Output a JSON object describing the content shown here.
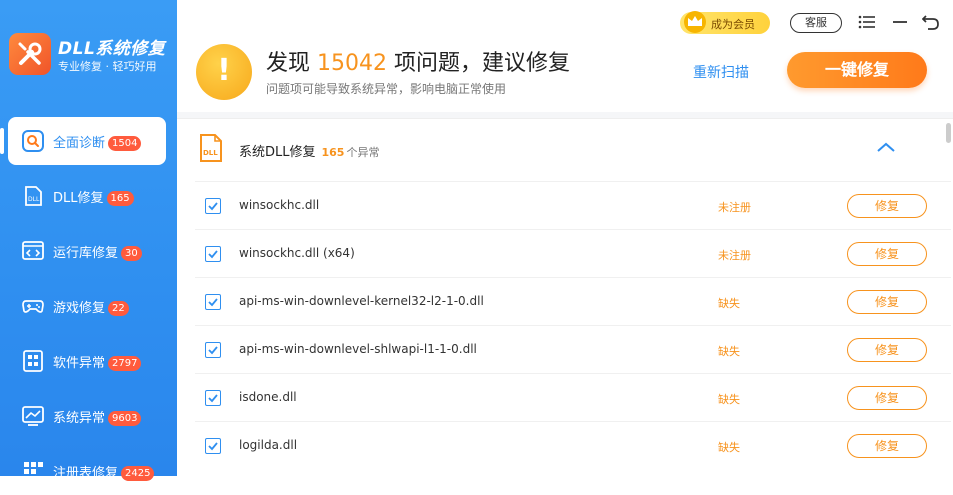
{
  "app": {
    "name": "DLL系统修复",
    "slogan": "专业修复 · 轻巧好用"
  },
  "topbar": {
    "vip_label": "成为会员",
    "service_label": "客服"
  },
  "header": {
    "prefix": "发现 ",
    "count": "15042",
    "suffix": " 项问题，建议修复",
    "subtitle": "问题项可能导致系统异常，影响电脑正常使用",
    "rescan_label": "重新扫描",
    "fix_all_label": "一键修复"
  },
  "sidebar": {
    "items": [
      {
        "label": "全面诊断",
        "badge": "1504",
        "icon": "search-icon"
      },
      {
        "label": "DLL修复",
        "badge": "165",
        "icon": "dll-icon"
      },
      {
        "label": "运行库修复",
        "badge": "30",
        "icon": "code-icon"
      },
      {
        "label": "游戏修复",
        "badge": "22",
        "icon": "gamepad-icon"
      },
      {
        "label": "软件异常",
        "badge": "2797",
        "icon": "apps-icon"
      },
      {
        "label": "系统异常",
        "badge": "9603",
        "icon": "monitor-chart-icon"
      },
      {
        "label": "注册表修复",
        "badge": "2425",
        "icon": "registry-icon"
      }
    ]
  },
  "section": {
    "title": "系统DLL修复",
    "count": "165",
    "unit": "个异常"
  },
  "rows": [
    {
      "name": "winsockhc.dll",
      "status": "未注册",
      "fix_label": "修复"
    },
    {
      "name": "winsockhc.dll (x64)",
      "status": "未注册",
      "fix_label": "修复"
    },
    {
      "name": "api-ms-win-downlevel-kernel32-l2-1-0.dll",
      "status": "缺失",
      "fix_label": "修复"
    },
    {
      "name": "api-ms-win-downlevel-shlwapi-l1-1-0.dll",
      "status": "缺失",
      "fix_label": "修复"
    },
    {
      "name": "isdone.dll",
      "status": "缺失",
      "fix_label": "修复"
    },
    {
      "name": "logilda.dll",
      "status": "缺失",
      "fix_label": "修复"
    }
  ],
  "colors": {
    "primary": "#2f8ff0",
    "accent": "#f7931e",
    "badge": "#ff5b3d"
  }
}
